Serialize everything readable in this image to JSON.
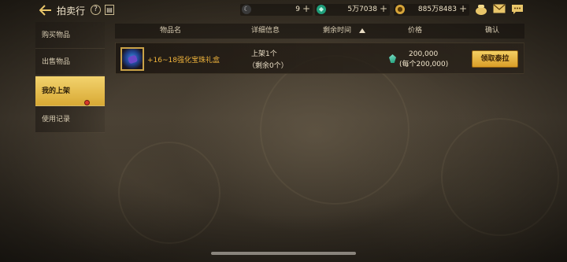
{
  "header": {
    "title": "拍卖行",
    "help_icon": "question-circle-icon",
    "book_icon": "book-icon",
    "currencies": [
      {
        "icon": "moon-coin-icon",
        "value": "9",
        "plus": "+"
      },
      {
        "icon": "green-gem-icon",
        "value": "5万7038",
        "plus": "+"
      },
      {
        "icon": "gold-coin-icon",
        "value": "885万8483",
        "plus": "+"
      }
    ],
    "right_icons": [
      "treasure-pot-icon",
      "mail-icon",
      "chat-icon"
    ]
  },
  "sidebar": {
    "items": [
      {
        "label": "购买物品",
        "active": false
      },
      {
        "label": "出售物品",
        "active": false
      },
      {
        "label": "我的上架",
        "active": true,
        "badge": true
      },
      {
        "label": "使用记录",
        "active": false
      }
    ]
  },
  "table": {
    "headers": {
      "name": "物品名",
      "detail": "详细信息",
      "time": "剩余时间",
      "price": "价格",
      "confirm": "确认"
    },
    "rows": [
      {
        "name": "+16~18强化宝珠礼盒",
        "detail_line1": "上架1个",
        "detail_line2": "（剩余0个）",
        "price": "200,000",
        "price_each": "(每个200,000)",
        "button": "领取泰拉"
      }
    ]
  },
  "colors": {
    "accent_gold": "#f3d36e",
    "item_name": "#f0b43c",
    "badge_red": "#d8382a"
  }
}
